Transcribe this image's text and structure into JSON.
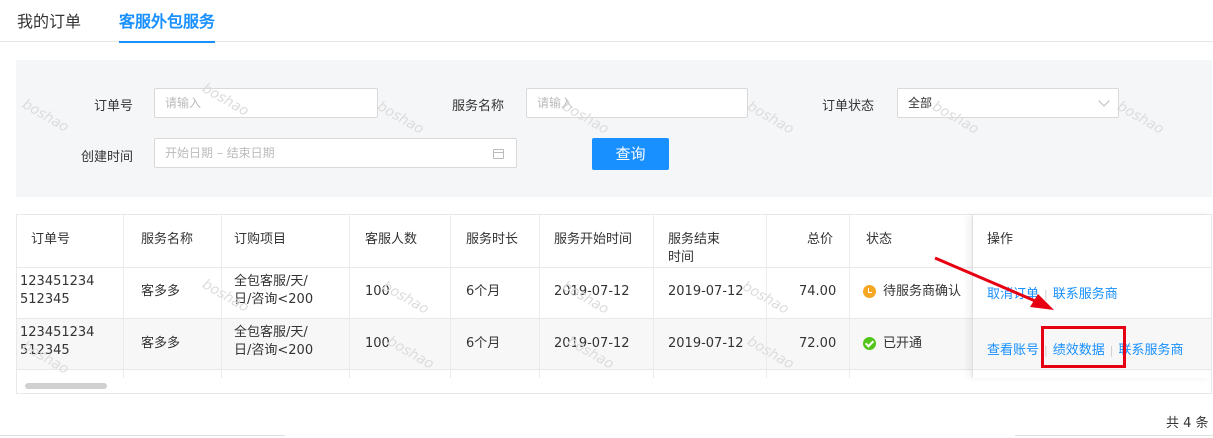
{
  "tabs": [
    {
      "label": "我的订单"
    },
    {
      "label": "客服外包服务"
    }
  ],
  "filters": {
    "order_no_label": "订单号",
    "order_no_placeholder": "请输入",
    "service_name_label": "服务名称",
    "service_name_placeholder": "请输入",
    "status_label": "订单状态",
    "status_value": "全部",
    "created_label": "创建时间",
    "date_range_placeholder": "开始日期 – 结束日期",
    "query_button": "查询"
  },
  "table": {
    "headers": [
      "订单号",
      "服务名称",
      "订购项目",
      "客服人数",
      "服务时长",
      "服务开始时间",
      "服务结束时间",
      "总价",
      "状态",
      "操作"
    ],
    "header_end_time_line1": "服务结束",
    "header_end_time_line2": "时间",
    "rows": [
      {
        "order_no_line1": "123451234",
        "order_no_line2": "512345",
        "service_name": "客多多",
        "item_line1": "全包客服/天/",
        "item_line2": "日/咨询<200",
        "staff": "100",
        "duration": "6个月",
        "start": "2019-07-12",
        "end": "2019-07-12",
        "price": "74.00",
        "status": "待服务商确认",
        "actions": [
          "取消订单",
          "联系服务商"
        ]
      },
      {
        "order_no_line1": "123451234",
        "order_no_line2": "512345",
        "service_name": "客多多",
        "item_line1": "全包客服/天/",
        "item_line2": "日/咨询<200",
        "staff": "100",
        "duration": "6个月",
        "start": "2019-07-12",
        "end": "2019-07-12",
        "price": "72.00",
        "status": "已开通",
        "actions": [
          "查看账号",
          "绩效数据",
          "联系服务商"
        ]
      }
    ]
  },
  "footer": {
    "total": "共 4 条"
  },
  "watermark": "boshao",
  "colors": {
    "accent": "#1890ff",
    "pending": "#f5a623",
    "success": "#52c41a",
    "annotation": "#e60012"
  }
}
